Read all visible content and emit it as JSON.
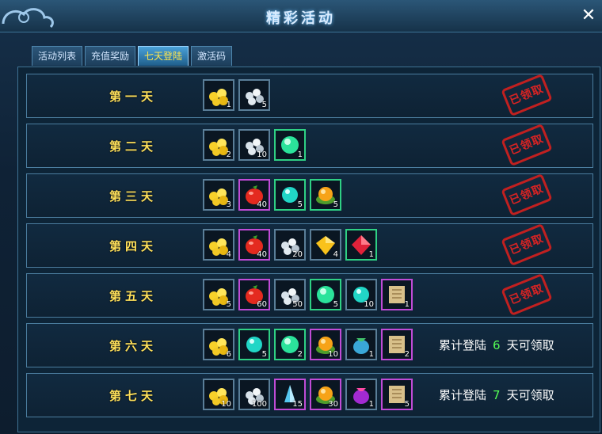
{
  "window": {
    "title": "精彩活动"
  },
  "tabs": [
    {
      "label": "活动列表",
      "active": false
    },
    {
      "label": "充值奖励",
      "active": false
    },
    {
      "label": "七天登陆",
      "active": true
    },
    {
      "label": "激活码",
      "active": false
    }
  ],
  "days": [
    {
      "label": "第一天",
      "stamp": "已领取",
      "status": null,
      "items": [
        {
          "icon": "gold-ore-icon",
          "count": "1",
          "quality": "normal"
        },
        {
          "icon": "silver-ore-icon",
          "count": "5",
          "quality": "normal"
        }
      ]
    },
    {
      "label": "第二天",
      "stamp": "已领取",
      "status": null,
      "items": [
        {
          "icon": "gold-ore-icon",
          "count": "2",
          "quality": "normal"
        },
        {
          "icon": "silver-ore-icon",
          "count": "10",
          "quality": "normal"
        },
        {
          "icon": "green-orb-icon",
          "count": "1",
          "quality": "green"
        }
      ]
    },
    {
      "label": "第三天",
      "stamp": "已领取",
      "status": null,
      "items": [
        {
          "icon": "gold-ore-icon",
          "count": "3",
          "quality": "normal"
        },
        {
          "icon": "red-fruit-icon",
          "count": "40",
          "quality": "purple"
        },
        {
          "icon": "cyan-orb-icon",
          "count": "5",
          "quality": "green"
        },
        {
          "icon": "orange-orb-icon",
          "count": "5",
          "quality": "green"
        }
      ]
    },
    {
      "label": "第四天",
      "stamp": "已领取",
      "status": null,
      "items": [
        {
          "icon": "gold-ore-icon",
          "count": "4",
          "quality": "normal"
        },
        {
          "icon": "red-fruit-icon",
          "count": "40",
          "quality": "purple"
        },
        {
          "icon": "silver-ore-icon",
          "count": "20",
          "quality": "normal"
        },
        {
          "icon": "gold-gem-icon",
          "count": "4",
          "quality": "normal"
        },
        {
          "icon": "ruby-icon",
          "count": "1",
          "quality": "green"
        }
      ]
    },
    {
      "label": "第五天",
      "stamp": "已领取",
      "status": null,
      "items": [
        {
          "icon": "gold-ore-icon",
          "count": "5",
          "quality": "normal"
        },
        {
          "icon": "red-fruit-icon",
          "count": "60",
          "quality": "purple"
        },
        {
          "icon": "silver-ore-icon",
          "count": "50",
          "quality": "normal"
        },
        {
          "icon": "green-orb-icon",
          "count": "5",
          "quality": "green"
        },
        {
          "icon": "cyan-orb-icon",
          "count": "10",
          "quality": "normal"
        },
        {
          "icon": "scroll-icon",
          "count": "1",
          "quality": "purple"
        }
      ]
    },
    {
      "label": "第六天",
      "stamp": null,
      "status": {
        "before": "累计登陆",
        "num": "6",
        "after": "天可领取"
      },
      "items": [
        {
          "icon": "gold-ore-icon",
          "count": "6",
          "quality": "normal"
        },
        {
          "icon": "cyan-orb-icon",
          "count": "5",
          "quality": "green"
        },
        {
          "icon": "green-orb-icon",
          "count": "2",
          "quality": "green"
        },
        {
          "icon": "orange-orb-icon",
          "count": "10",
          "quality": "purple"
        },
        {
          "icon": "green-pouch-icon",
          "count": "1",
          "quality": "normal"
        },
        {
          "icon": "scroll-icon",
          "count": "2",
          "quality": "purple"
        }
      ]
    },
    {
      "label": "第七天",
      "stamp": null,
      "status": {
        "before": "累计登陆",
        "num": "7",
        "after": "天可领取"
      },
      "items": [
        {
          "icon": "gold-ore-icon",
          "count": "10",
          "quality": "normal"
        },
        {
          "icon": "silver-ore-icon",
          "count": "100",
          "quality": "normal"
        },
        {
          "icon": "blue-crystal-icon",
          "count": "15",
          "quality": "purple"
        },
        {
          "icon": "orange-orb-icon",
          "count": "30",
          "quality": "purple"
        },
        {
          "icon": "purple-pouch-icon",
          "count": "1",
          "quality": "normal"
        },
        {
          "icon": "scroll-icon",
          "count": "5",
          "quality": "purple"
        }
      ]
    }
  ]
}
